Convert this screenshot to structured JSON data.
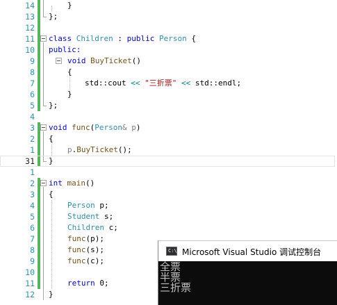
{
  "line_numbers": [
    "14",
    "13",
    "12",
    "11",
    "10",
    "9",
    "8",
    "7",
    "6",
    "5",
    "4",
    "3",
    "2",
    "1",
    "31",
    "1",
    "2",
    "3",
    "4",
    "5",
    "6",
    "7",
    "8",
    "9",
    "10",
    "11",
    "12"
  ],
  "code": {
    "l14_close": "}",
    "l13_close": "};",
    "class_kw": "class",
    "class_name": "Children",
    "colon": " : ",
    "public_kw": "public",
    "base_name": "Person",
    "brace_open": " {",
    "public_label": "public:",
    "void_kw": "void",
    "buy_fn": "BuyTicket",
    "parens": "()",
    "open_brace": "{",
    "std1": "std",
    "scope": "::",
    "cout": "cout",
    "shift1": " << ",
    "str_literal": "\"三折票\"",
    "shift2": " << ",
    "std2": "std",
    "endl": "endl",
    "semi": ";",
    "close_brace": "}",
    "close_semi": "};",
    "func_kw": "void",
    "func_name": "func",
    "func_param_type": "Person",
    "func_param": "& p",
    "func_close": ")",
    "func_open": "(",
    "call_obj": "p",
    "call_dot": ".",
    "call_fn": "BuyTicket",
    "call_end": "();",
    "int_kw": "int",
    "main_fn": "main",
    "main_parens": "()",
    "decl_p_type": "Person",
    "decl_p_name": " p;",
    "decl_s_type": "Student",
    "decl_s_name": " s;",
    "decl_c_type": "Children",
    "decl_c_name": " c;",
    "call_p_fn": "func",
    "call_p_arg": "(p);",
    "call_s_fn": "func",
    "call_s_arg": "(s);",
    "call_c_fn": "func",
    "call_c_arg": "(c);",
    "return_kw": "return",
    "return_val": " 0;"
  },
  "console": {
    "title": "Microsoft Visual Studio 调试控制台",
    "icon_label": "C:\\",
    "output": [
      "全票",
      "半票",
      "三折票"
    ]
  },
  "colors": {
    "keyword": "#0000ff",
    "type": "#2b91af",
    "function": "#74531f",
    "string": "#a31515",
    "line_number": "#2b91af",
    "change_saved": "#57b35c",
    "console_bg": "#0c0c0c"
  }
}
